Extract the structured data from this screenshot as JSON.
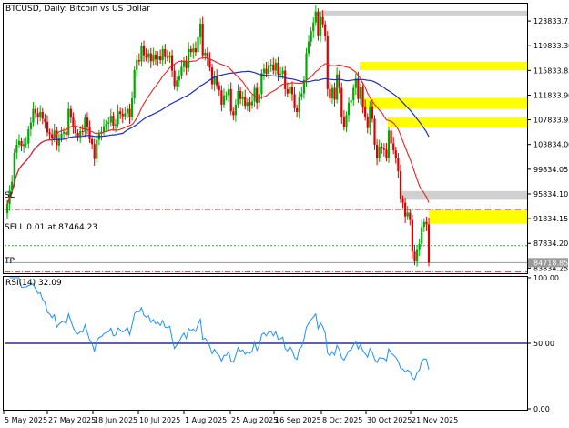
{
  "window": {
    "symbol_title": "BTCUSD, Daily:  Bitcoin vs US Dollar",
    "sl_label": "SL",
    "tp_label": "TP",
    "sell_label": "SELL 0.01 at 87464.23",
    "current_price_label": "84718.85",
    "rsi_label": "RSI(14) 32.09"
  },
  "colors": {
    "bull": "#00aa00",
    "bear": "#dd0000",
    "ma_fast": "#ee2222",
    "ma_slow": "#1a2bbb",
    "zone_yellow": "#ffff00",
    "zone_gray": "#d0d0d0",
    "rsi_line": "#1e90ff"
  },
  "chart_data": [
    {
      "type": "candlestick",
      "title": "BTCUSD, Daily:  Bitcoin vs US Dollar",
      "ylim": [
        83000,
        126500
      ],
      "y_ticks": [
        "123833.75",
        "119833.30",
        "115833.85",
        "111833.90",
        "107833.95",
        "103834.00",
        "99834.05",
        "95834.10",
        "91834.15",
        "87834.20",
        "83834.25"
      ],
      "x_ticks": [
        "5 May 2025",
        "27 May 2025",
        "18 Jun 2025",
        "10 Jul 2025",
        "1 Aug 2025",
        "25 Aug 2025",
        "16 Sep 2025",
        "8 Oct 2025",
        "30 Oct 2025",
        "21 Nov 2025"
      ],
      "close_series": [
        94200,
        96400,
        97800,
        102500,
        103800,
        104400,
        103600,
        103900,
        104000,
        106300,
        107400,
        109600,
        108900,
        108200,
        109100,
        108000,
        107500,
        105800,
        105500,
        104800,
        106100,
        103700,
        104800,
        105600,
        105900,
        105400,
        109600,
        108200,
        106700,
        105700,
        105200,
        106000,
        105900,
        108200,
        106600,
        104700,
        103900,
        101500,
        104600,
        105600,
        105900,
        106800,
        107200,
        107400,
        108500,
        106900,
        107100,
        109200,
        108800,
        108400,
        108900,
        109600,
        108300,
        111300,
        115900,
        117500,
        117300,
        119800,
        118300,
        117900,
        118600,
        117300,
        118400,
        117600,
        118100,
        117500,
        119300,
        118000,
        117900,
        118300,
        115800,
        113300,
        114200,
        115000,
        116400,
        117400,
        116200,
        119300,
        118800,
        119400,
        118800,
        121200,
        123400,
        118300,
        118700,
        117700,
        116300,
        113600,
        114900,
        113400,
        112600,
        110300,
        111800,
        111800,
        112800,
        109200,
        108600,
        110300,
        112500,
        111200,
        111600,
        110100,
        110700,
        110200,
        110800,
        113000,
        110600,
        112000,
        115400,
        116100,
        115300,
        116700,
        116800,
        115800,
        117100,
        115200,
        115300,
        115800,
        112800,
        112100,
        113200,
        112000,
        109700,
        109100,
        111600,
        112100,
        114300,
        118600,
        120500,
        122200,
        123600,
        125300,
        121500,
        124500,
        123300,
        121400,
        112800,
        111300,
        113000,
        111100,
        115200,
        113000,
        108300,
        106700,
        108600,
        110600,
        111000,
        113000,
        114500,
        111200,
        113100,
        110000,
        108300,
        106500,
        110000,
        108000,
        103800,
        101600,
        103500,
        103200,
        103000,
        101700,
        106100,
        104000,
        102900,
        101600,
        99500,
        95000,
        94400,
        92200,
        92800,
        91600,
        86500,
        84900,
        86900,
        87700,
        90500,
        91300,
        90900,
        84700
      ],
      "moving_averages": [
        "fast (red)",
        "slow (blue)"
      ],
      "zones": [
        {
          "color": "gray",
          "from": 125500,
          "to": 124600
        },
        {
          "color": "yellow",
          "from": 117200,
          "to": 115900
        },
        {
          "color": "yellow",
          "from": 111400,
          "to": 109600
        },
        {
          "color": "yellow",
          "from": 108200,
          "to": 106600
        },
        {
          "color": "gray",
          "from": 96300,
          "to": 94900
        },
        {
          "color": "yellow",
          "from": 93200,
          "to": 91000
        }
      ],
      "levels": {
        "sl": 93300,
        "sell": 87464.23,
        "current": 84718.85,
        "tp": 83200
      }
    },
    {
      "type": "line",
      "title": "RSI(14) 32.09",
      "ylim": [
        0,
        100
      ],
      "y_ticks": [
        "100.00",
        "50.00",
        "0.00"
      ],
      "level_line": 50,
      "last_value": 32.09
    }
  ]
}
